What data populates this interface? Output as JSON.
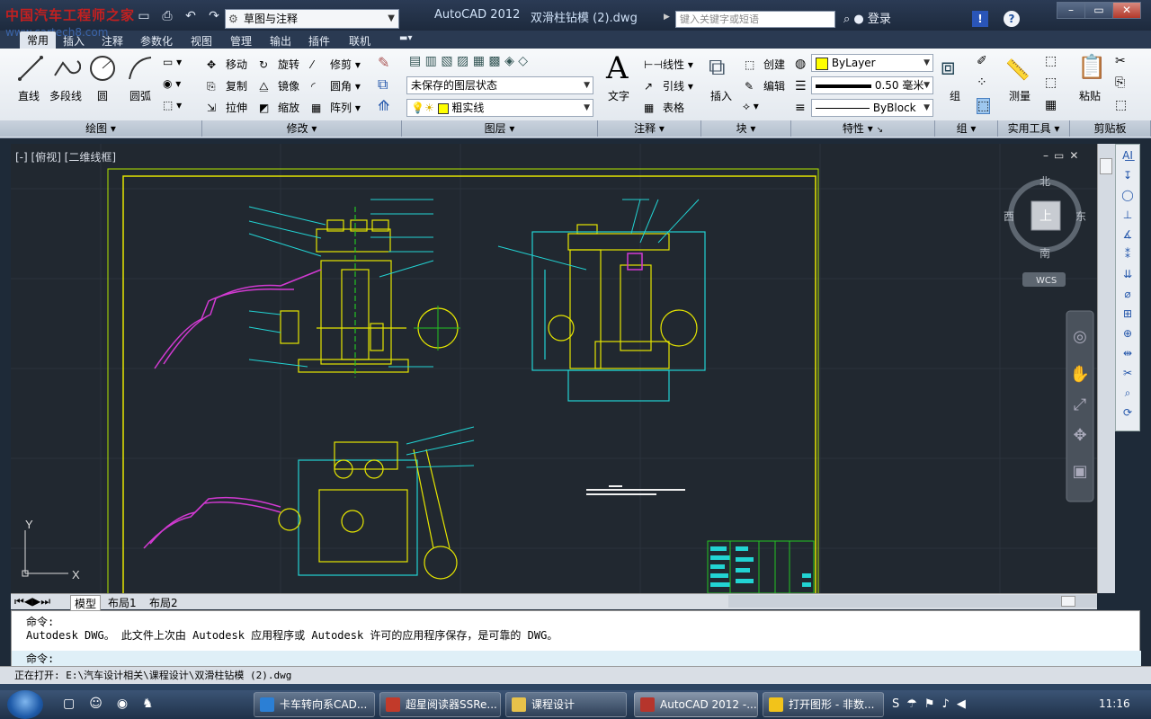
{
  "titlebar": {
    "logo": "中国汽车工程师之家",
    "logo_sub": "www.cartech8.com",
    "workspace": "草图与注释",
    "app_name": "AutoCAD 2012",
    "file_name": "双滑柱钻模 (2).dwg",
    "search_placeholder": "键入关键字或短语",
    "login": "登录"
  },
  "tabs": [
    "常用",
    "插入",
    "注释",
    "参数化",
    "视图",
    "管理",
    "输出",
    "插件",
    "联机"
  ],
  "ribbon": {
    "draw": {
      "title": "绘图",
      "line": "直线",
      "polyline": "多段线",
      "circle": "圆",
      "arc": "圆弧"
    },
    "modify": {
      "title": "修改",
      "move": "移动",
      "rotate": "旋转",
      "trim": "修剪",
      "copy": "复制",
      "mirror": "镜像",
      "fillet": "圆角",
      "stretch": "拉伸",
      "scale": "缩放",
      "array": "阵列"
    },
    "layers": {
      "title": "图层",
      "state": "未保存的图层状态",
      "current": "粗实线"
    },
    "annotation": {
      "title": "注释",
      "text": "文字",
      "linear": "线性",
      "leader": "引线",
      "table": "表格"
    },
    "block": {
      "title": "块",
      "insert": "插入",
      "create": "创建",
      "edit": "编辑"
    },
    "properties": {
      "title": "特性",
      "color": "ByLayer",
      "lineweight": "0.50 毫米",
      "linetype": "ByBlock"
    },
    "groups": {
      "title": "组",
      "group": "组"
    },
    "utilities": {
      "title": "实用工具",
      "measure": "测量"
    },
    "clipboard": {
      "title": "剪贴板",
      "paste": "粘贴"
    }
  },
  "viewport": {
    "label": "[-] [俯视] [二维线框]",
    "viewcube": {
      "north": "北",
      "south": "南",
      "east": "东",
      "west": "西",
      "top": "上",
      "wcs": "WCS"
    },
    "ucs": {
      "x": "X",
      "y": "Y"
    }
  },
  "layout_tabs": [
    "模型",
    "布局1",
    "布局2"
  ],
  "command": {
    "line1": "命令:",
    "line2": "Autodesk DWG。  此文件上次由 Autodesk 应用程序或 Autodesk 许可的应用程序保存，是可靠的 DWG。",
    "prompt": "命令:"
  },
  "status": "正在打开: E:\\汽车设计相关\\课程设计\\双滑柱钻模 (2).dwg",
  "taskbar": {
    "items": [
      "卡车转向系CAD...",
      "超星阅读器SSRe...",
      "课程设计",
      "AutoCAD 2012 -...",
      "打开图形 - 非数..."
    ],
    "clock": "11:16"
  },
  "colors": {
    "drawing_bg": "#212830",
    "frame": "#e6e600",
    "cyan": "#22d3d3",
    "magenta": "#d23ad2",
    "green": "#22c322",
    "red": "#e23030"
  }
}
